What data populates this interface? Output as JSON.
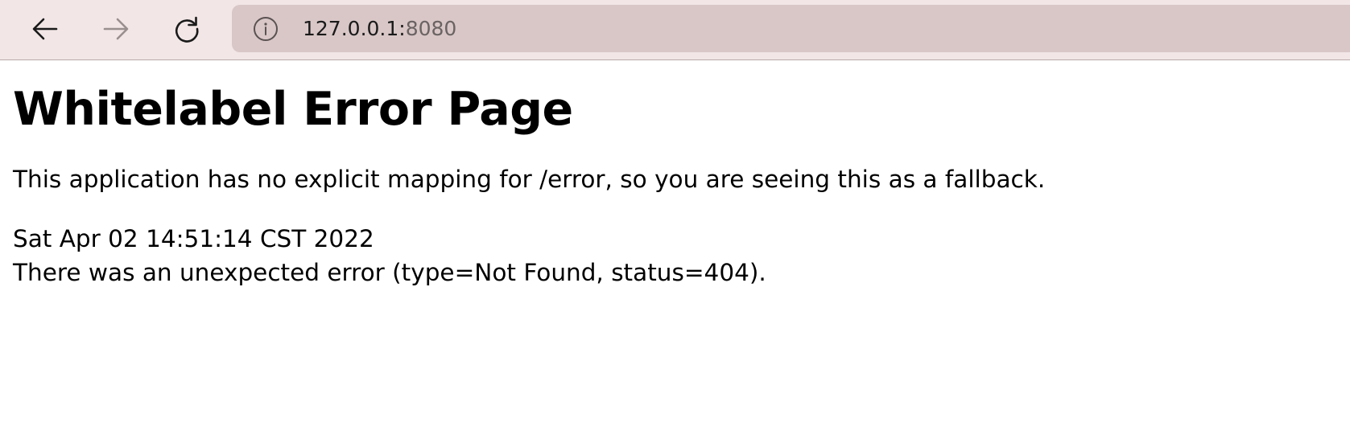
{
  "browser": {
    "url_host": "127.0.0.1:",
    "url_port": "8080",
    "icons": {
      "back": "arrow-left-icon",
      "forward": "arrow-right-icon",
      "reload": "reload-icon",
      "site_info": "info-icon"
    },
    "colors": {
      "toolbar_bg": "#f2e6e6",
      "address_bar_bg": "#d9c7c7",
      "forward_disabled": "#9a8f8f"
    }
  },
  "page": {
    "title": "Whitelabel Error Page",
    "description": "This application has no explicit mapping for /error, so you are seeing this as a fallback.",
    "timestamp": "Sat Apr 02 14:51:14 CST 2022",
    "error_message": "There was an unexpected error (type=Not Found, status=404)."
  }
}
